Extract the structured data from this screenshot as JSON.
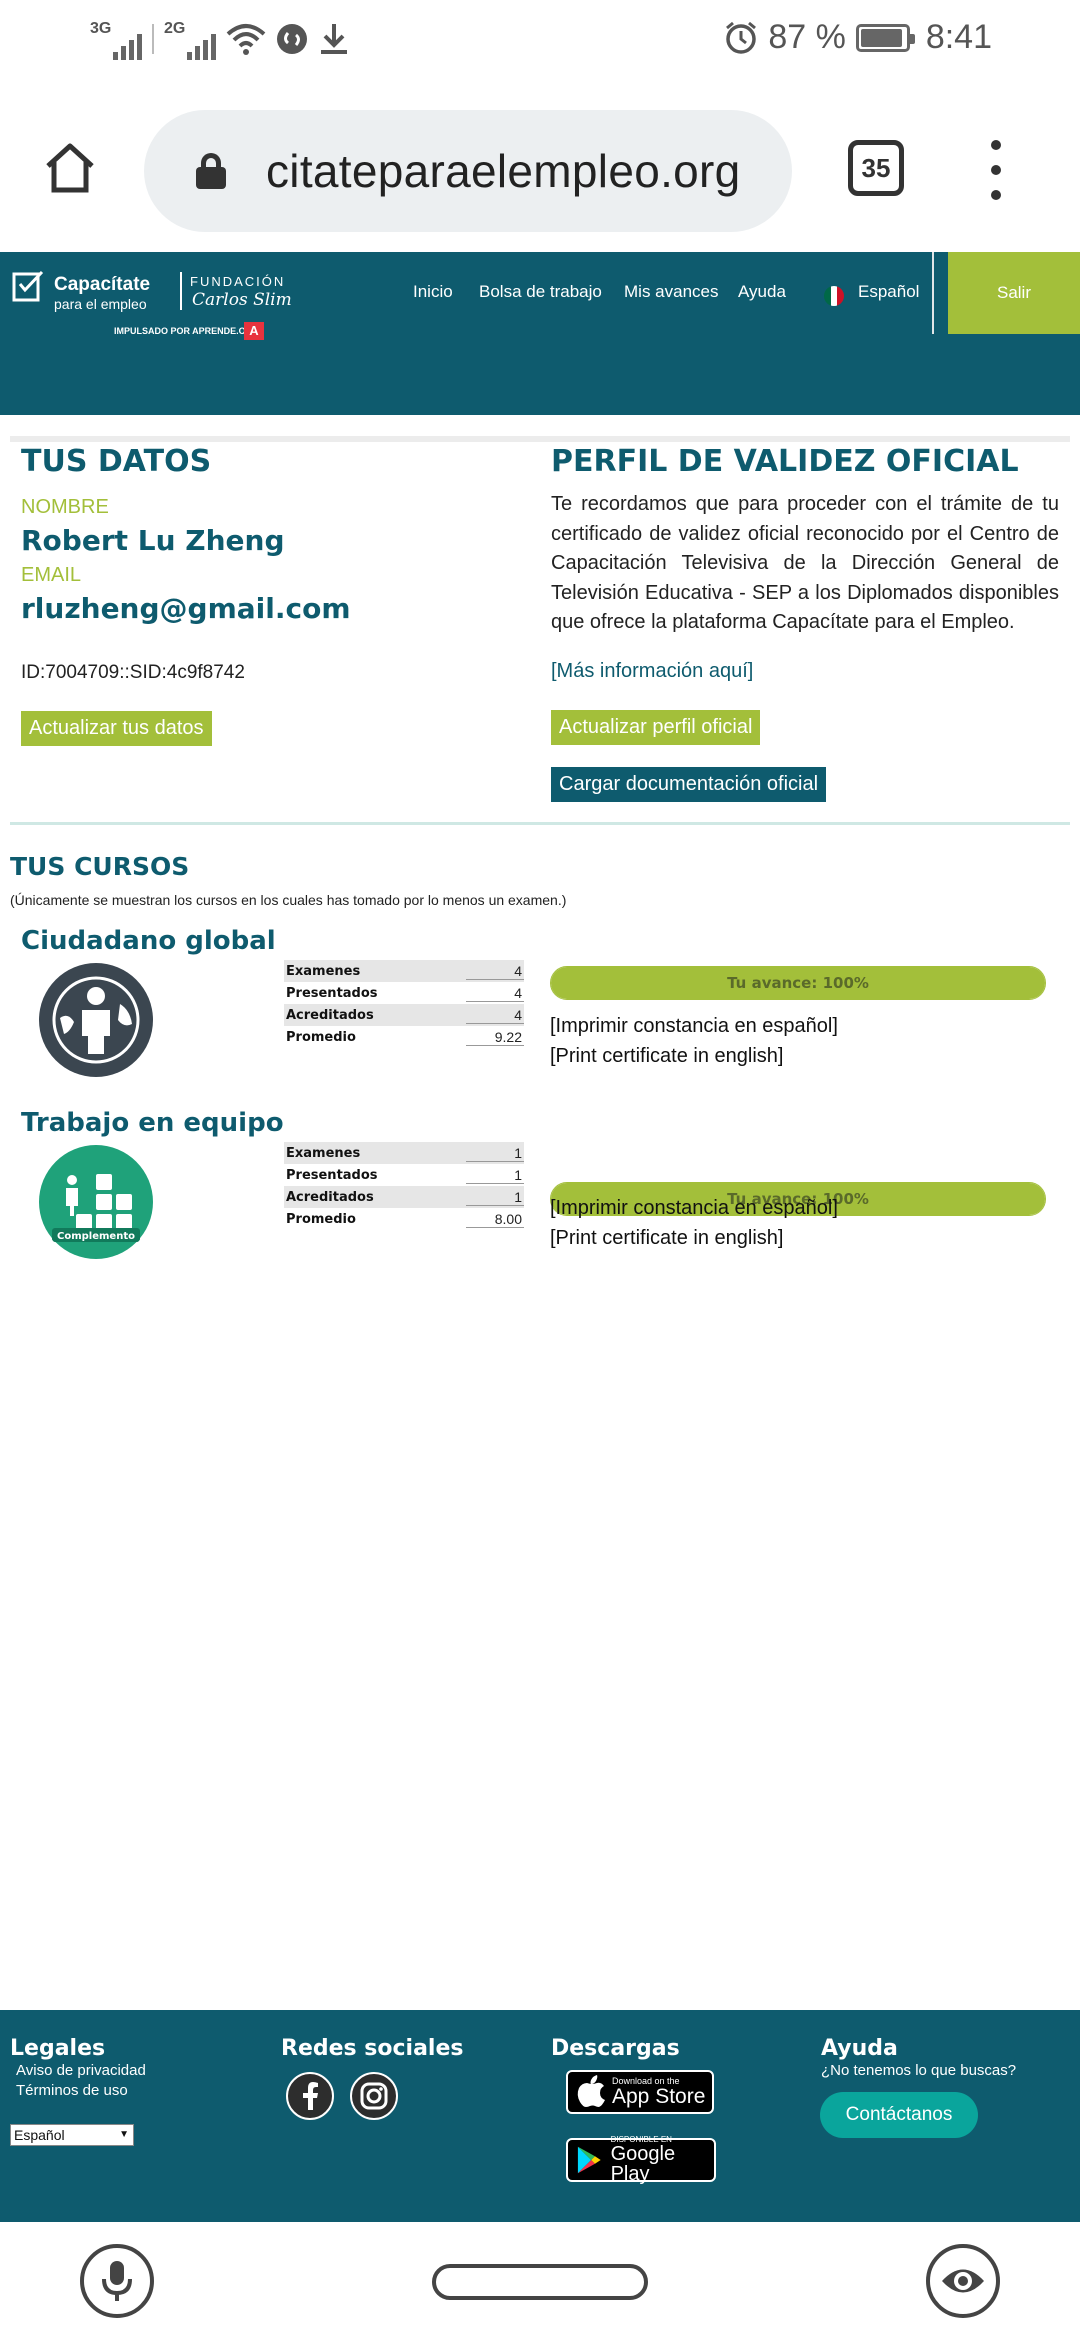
{
  "status_bar": {
    "net1": "3G",
    "net2": "2G",
    "battery": "87 %",
    "time": "8:41",
    "icons": [
      "wifi-icon",
      "shazam-icon",
      "download-icon",
      "alarm-icon",
      "battery-icon"
    ]
  },
  "browser": {
    "url": "citateparaelempleo.org",
    "tab_count": "35"
  },
  "header": {
    "logo": {
      "brand": "Capacítate",
      "brand_sub": "para el empleo",
      "foundation": "FUNDACIÓN",
      "foundation_name": "Carlos Slim",
      "powered": "IMPULSADO POR APRENDE.ORG",
      "badge": "A"
    },
    "nav": [
      "Inicio",
      "Bolsa de trabajo",
      "Mis avances",
      "Ayuda"
    ],
    "language": "Español",
    "logout": "Salir",
    "flag_colors": [
      "#006847",
      "#ffffff",
      "#ce1126"
    ]
  },
  "datos": {
    "title": "TUS DATOS",
    "name_label": "NOMBRE",
    "name": "Robert Lu Zheng",
    "email_label": "EMAIL",
    "email": "rluzheng@gmail.com",
    "id": "ID:7004709::SID:4c9f8742",
    "update_button": "Actualizar tus datos"
  },
  "perfil": {
    "title": "PERFIL DE VALIDEZ OFICIAL",
    "text": "Te recordamos que para proceder con el trámite de tu certificado de validez oficial reconocido por el Centro de Capacitación Televisiva de la Dirección General de Televisión Educativa - SEP a los Diplomados disponibles que ofrece la plataforma Capacítate para el Empleo.",
    "more_info": "[Más información aquí]",
    "update_button": "Actualizar perfil oficial",
    "upload_button": "Cargar documentación oficial"
  },
  "cursos": {
    "title": "TUS CURSOS",
    "note": "(Únicamente se muestran los cursos en los cuales has tomado por lo menos un examen.)",
    "items": [
      {
        "title": "Ciudadano global",
        "stats": [
          {
            "k": "Examenes",
            "v": "4"
          },
          {
            "k": "Presentados",
            "v": "4"
          },
          {
            "k": "Acreditados",
            "v": "4"
          },
          {
            "k": "Promedio",
            "v": "9.22"
          }
        ],
        "progress_label": "Tu avance: 100%",
        "progress": 1.0,
        "link_es": "[Imprimir constancia en español]",
        "link_en": "[Print certificate in english]"
      },
      {
        "title": "Trabajo en equipo",
        "badge": "Complemento",
        "stats": [
          {
            "k": "Examenes",
            "v": "1"
          },
          {
            "k": "Presentados",
            "v": "1"
          },
          {
            "k": "Acreditados",
            "v": "1"
          },
          {
            "k": "Promedio",
            "v": "8.00"
          }
        ],
        "progress_label": "Tu avance: 100%",
        "progress": 1.0,
        "link_es": "[Imprimir constancia en español]",
        "link_en": "[Print certificate in english]"
      }
    ]
  },
  "footer": {
    "legales": {
      "title": "Legales",
      "links": [
        "Aviso de privacidad",
        "Términos de uso"
      ],
      "language_select": "Español"
    },
    "redes": {
      "title": "Redes sociales"
    },
    "descargas": {
      "title": "Descargas",
      "app_store_small": "Download on the",
      "app_store": "App Store",
      "google_small": "DISPONIBLE EN",
      "google": "Google Play"
    },
    "ayuda": {
      "title": "Ayuda",
      "question": "¿No tenemos lo que buscas?",
      "contact": "Contáctanos"
    }
  },
  "colors": {
    "teal": "#0e5b6e",
    "green": "#a3bf3a",
    "contact": "#0aa59c"
  }
}
